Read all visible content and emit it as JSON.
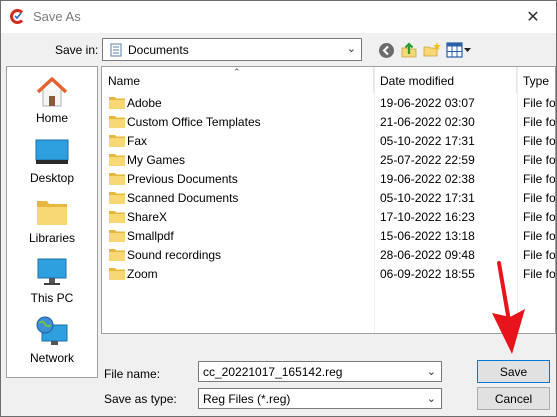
{
  "window": {
    "title": "Save As",
    "close_glyph": "✕"
  },
  "save_in": {
    "label": "Save in:",
    "value": "Documents"
  },
  "toolbar": {
    "icons": [
      "back-icon",
      "up-folder-icon",
      "new-folder-icon",
      "view-menu-icon"
    ]
  },
  "places": [
    {
      "label": "Home",
      "icon": "home-icon"
    },
    {
      "label": "Desktop",
      "icon": "desktop-icon"
    },
    {
      "label": "Libraries",
      "icon": "libraries-icon"
    },
    {
      "label": "This PC",
      "icon": "this-pc-icon"
    },
    {
      "label": "Network",
      "icon": "network-icon"
    }
  ],
  "columns": {
    "name": "Name",
    "date": "Date modified",
    "type": "Type"
  },
  "files": [
    {
      "name": "Adobe",
      "date": "19-06-2022 03:07",
      "type": "File fo"
    },
    {
      "name": "Custom Office Templates",
      "date": "21-06-2022 02:30",
      "type": "File fo"
    },
    {
      "name": "Fax",
      "date": "05-10-2022 17:31",
      "type": "File fo"
    },
    {
      "name": "My Games",
      "date": "25-07-2022 22:59",
      "type": "File fo"
    },
    {
      "name": "Previous Documents",
      "date": "19-06-2022 02:38",
      "type": "File fo"
    },
    {
      "name": "Scanned Documents",
      "date": "05-10-2022 17:31",
      "type": "File fo"
    },
    {
      "name": "ShareX",
      "date": "17-10-2022 16:23",
      "type": "File fo"
    },
    {
      "name": "Smallpdf",
      "date": "15-06-2022 13:18",
      "type": "File fo"
    },
    {
      "name": "Sound recordings",
      "date": "28-06-2022 09:48",
      "type": "File fo"
    },
    {
      "name": "Zoom",
      "date": "06-09-2022 18:55",
      "type": "File fo"
    }
  ],
  "file_name": {
    "label": "File name:",
    "value": "cc_20221017_165142.reg"
  },
  "save_as_type": {
    "label": "Save as type:",
    "value": "Reg Files (*.reg)"
  },
  "buttons": {
    "save": "Save",
    "cancel": "Cancel"
  },
  "colors": {
    "folder": "#f8d775",
    "accent": "#0078d7",
    "arrow": "#e8141b"
  }
}
